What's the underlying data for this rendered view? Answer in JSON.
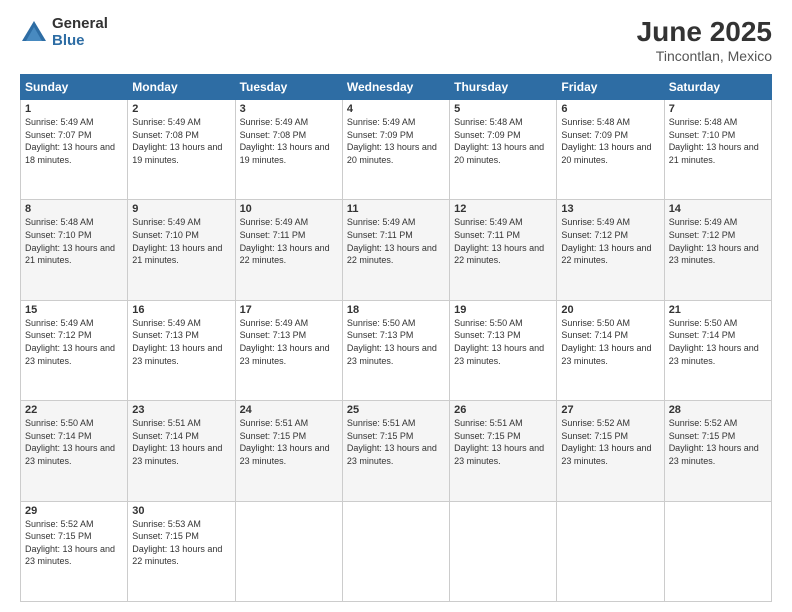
{
  "logo": {
    "general": "General",
    "blue": "Blue"
  },
  "title": {
    "month": "June 2025",
    "location": "Tincontlan, Mexico"
  },
  "headers": [
    "Sunday",
    "Monday",
    "Tuesday",
    "Wednesday",
    "Thursday",
    "Friday",
    "Saturday"
  ],
  "weeks": [
    [
      {
        "day": "1",
        "sunrise": "5:49 AM",
        "sunset": "7:07 PM",
        "daylight": "13 hours and 18 minutes."
      },
      {
        "day": "2",
        "sunrise": "5:49 AM",
        "sunset": "7:08 PM",
        "daylight": "13 hours and 19 minutes."
      },
      {
        "day": "3",
        "sunrise": "5:49 AM",
        "sunset": "7:08 PM",
        "daylight": "13 hours and 19 minutes."
      },
      {
        "day": "4",
        "sunrise": "5:49 AM",
        "sunset": "7:09 PM",
        "daylight": "13 hours and 20 minutes."
      },
      {
        "day": "5",
        "sunrise": "5:48 AM",
        "sunset": "7:09 PM",
        "daylight": "13 hours and 20 minutes."
      },
      {
        "day": "6",
        "sunrise": "5:48 AM",
        "sunset": "7:09 PM",
        "daylight": "13 hours and 20 minutes."
      },
      {
        "day": "7",
        "sunrise": "5:48 AM",
        "sunset": "7:10 PM",
        "daylight": "13 hours and 21 minutes."
      }
    ],
    [
      {
        "day": "8",
        "sunrise": "5:48 AM",
        "sunset": "7:10 PM",
        "daylight": "13 hours and 21 minutes."
      },
      {
        "day": "9",
        "sunrise": "5:49 AM",
        "sunset": "7:10 PM",
        "daylight": "13 hours and 21 minutes."
      },
      {
        "day": "10",
        "sunrise": "5:49 AM",
        "sunset": "7:11 PM",
        "daylight": "13 hours and 22 minutes."
      },
      {
        "day": "11",
        "sunrise": "5:49 AM",
        "sunset": "7:11 PM",
        "daylight": "13 hours and 22 minutes."
      },
      {
        "day": "12",
        "sunrise": "5:49 AM",
        "sunset": "7:11 PM",
        "daylight": "13 hours and 22 minutes."
      },
      {
        "day": "13",
        "sunrise": "5:49 AM",
        "sunset": "7:12 PM",
        "daylight": "13 hours and 22 minutes."
      },
      {
        "day": "14",
        "sunrise": "5:49 AM",
        "sunset": "7:12 PM",
        "daylight": "13 hours and 23 minutes."
      }
    ],
    [
      {
        "day": "15",
        "sunrise": "5:49 AM",
        "sunset": "7:12 PM",
        "daylight": "13 hours and 23 minutes."
      },
      {
        "day": "16",
        "sunrise": "5:49 AM",
        "sunset": "7:13 PM",
        "daylight": "13 hours and 23 minutes."
      },
      {
        "day": "17",
        "sunrise": "5:49 AM",
        "sunset": "7:13 PM",
        "daylight": "13 hours and 23 minutes."
      },
      {
        "day": "18",
        "sunrise": "5:50 AM",
        "sunset": "7:13 PM",
        "daylight": "13 hours and 23 minutes."
      },
      {
        "day": "19",
        "sunrise": "5:50 AM",
        "sunset": "7:13 PM",
        "daylight": "13 hours and 23 minutes."
      },
      {
        "day": "20",
        "sunrise": "5:50 AM",
        "sunset": "7:14 PM",
        "daylight": "13 hours and 23 minutes."
      },
      {
        "day": "21",
        "sunrise": "5:50 AM",
        "sunset": "7:14 PM",
        "daylight": "13 hours and 23 minutes."
      }
    ],
    [
      {
        "day": "22",
        "sunrise": "5:50 AM",
        "sunset": "7:14 PM",
        "daylight": "13 hours and 23 minutes."
      },
      {
        "day": "23",
        "sunrise": "5:51 AM",
        "sunset": "7:14 PM",
        "daylight": "13 hours and 23 minutes."
      },
      {
        "day": "24",
        "sunrise": "5:51 AM",
        "sunset": "7:15 PM",
        "daylight": "13 hours and 23 minutes."
      },
      {
        "day": "25",
        "sunrise": "5:51 AM",
        "sunset": "7:15 PM",
        "daylight": "13 hours and 23 minutes."
      },
      {
        "day": "26",
        "sunrise": "5:51 AM",
        "sunset": "7:15 PM",
        "daylight": "13 hours and 23 minutes."
      },
      {
        "day": "27",
        "sunrise": "5:52 AM",
        "sunset": "7:15 PM",
        "daylight": "13 hours and 23 minutes."
      },
      {
        "day": "28",
        "sunrise": "5:52 AM",
        "sunset": "7:15 PM",
        "daylight": "13 hours and 23 minutes."
      }
    ],
    [
      {
        "day": "29",
        "sunrise": "5:52 AM",
        "sunset": "7:15 PM",
        "daylight": "13 hours and 23 minutes."
      },
      {
        "day": "30",
        "sunrise": "5:53 AM",
        "sunset": "7:15 PM",
        "daylight": "13 hours and 22 minutes."
      },
      null,
      null,
      null,
      null,
      null
    ]
  ]
}
